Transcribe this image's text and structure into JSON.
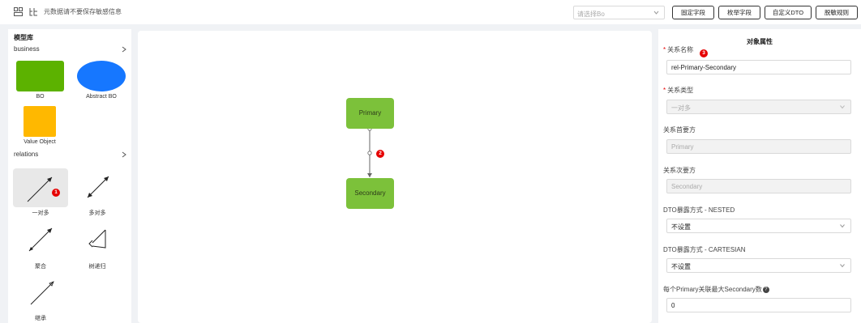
{
  "toolbar": {
    "notice": "元数据请不要保存敏感信息",
    "bo_select_placeholder": "请选择Bo",
    "buttons": [
      "固定字段",
      "枚举字段",
      "自定义DTO",
      "脱敏规则"
    ]
  },
  "library": {
    "title": "模型库",
    "business_section": "business",
    "business_items": [
      {
        "label": "BO",
        "color": "#5cb200",
        "shape": "rounded-rect"
      },
      {
        "label": "Abstract BO",
        "color": "#1677ff",
        "shape": "ellipse"
      },
      {
        "label": "Value Object",
        "color": "#ffb800",
        "shape": "rounded-rect"
      }
    ],
    "relations_section": "relations",
    "relation_items": [
      {
        "label": "一对多",
        "icon": "arrow-one-to-many-icon",
        "selected": true,
        "badge": "1"
      },
      {
        "label": "多对多",
        "icon": "arrow-many-to-many-icon"
      },
      {
        "label": "聚合",
        "icon": "arrow-aggregation-icon"
      },
      {
        "label": "树递归",
        "icon": "tree-recursion-icon"
      },
      {
        "label": "继承",
        "icon": "arrow-inheritance-icon"
      }
    ]
  },
  "canvas": {
    "nodes": [
      {
        "label": "Primary",
        "color": "#7cc13a"
      },
      {
        "label": "Secondary",
        "color": "#7cc13a"
      }
    ],
    "edge_badge": "2"
  },
  "properties": {
    "title": "对象属性",
    "relation_name_label": "关系名称",
    "relation_name_badge": "3",
    "relation_name_value": "rel-Primary-Secondary",
    "relation_type_label": "关系类型",
    "relation_type_value": "一对多",
    "primary_party_label": "关系首要方",
    "primary_party_value": "Primary",
    "secondary_party_label": "关系次要方",
    "secondary_party_value": "Secondary",
    "dto_nested_label": "DTO暴露方式 - NESTED",
    "dto_nested_value": "不设置",
    "dto_cartesian_label": "DTO暴露方式 - CARTESIAN",
    "dto_cartesian_value": "不设置",
    "max_count_label": "每个Primary关联最大Secondary数",
    "max_count_value": "0"
  }
}
